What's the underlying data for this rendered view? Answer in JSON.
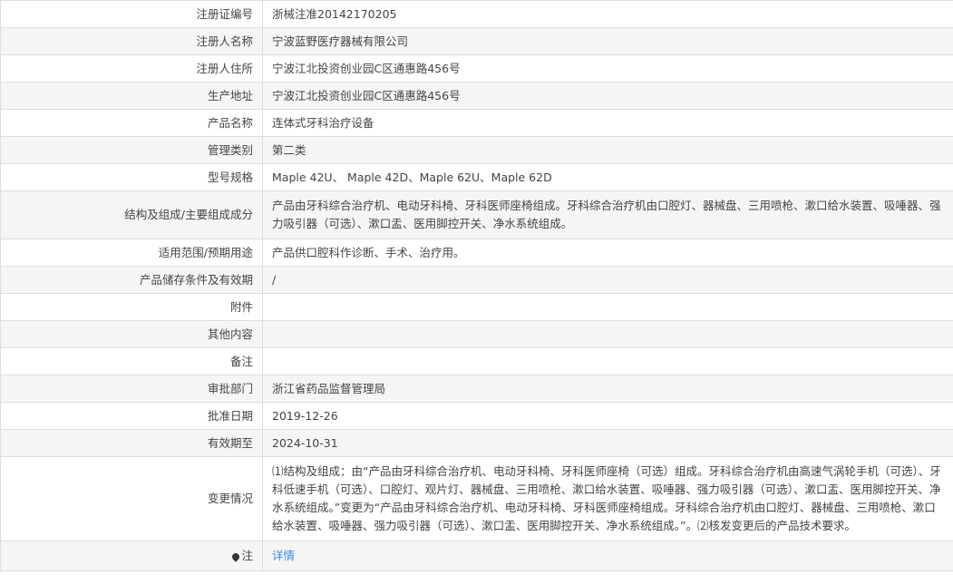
{
  "rows": [
    {
      "label": "注册证编号",
      "value": "浙械注准20142170205"
    },
    {
      "label": "注册人名称",
      "value": "宁波蓝野医疗器械有限公司"
    },
    {
      "label": "注册人住所",
      "value": "宁波江北投资创业园C区通惠路456号"
    },
    {
      "label": "生产地址",
      "value": "宁波江北投资创业园C区通惠路456号"
    },
    {
      "label": "产品名称",
      "value": "连体式牙科治疗设备"
    },
    {
      "label": "管理类别",
      "value": "第二类"
    },
    {
      "label": "型号规格",
      "value": "Maple 42U、 Maple 42D、Maple 62U、Maple 62D"
    },
    {
      "label": "结构及组成/主要组成成分",
      "value": "产品由牙科综合治疗机、电动牙科椅、牙科医师座椅组成。牙科综合治疗机由口腔灯、器械盘、三用喷枪、漱口给水装置、吸唾器、强力吸引器（可选）、漱口盂、医用脚控开关、净水系统组成。"
    },
    {
      "label": "适用范围/预期用途",
      "value": "产品供口腔科作诊断、手术、治疗用。"
    },
    {
      "label": "产品储存条件及有效期",
      "value": "/"
    },
    {
      "label": "附件",
      "value": ""
    },
    {
      "label": "其他内容",
      "value": ""
    },
    {
      "label": "备注",
      "value": ""
    },
    {
      "label": "审批部门",
      "value": "浙江省药品监督管理局"
    },
    {
      "label": "批准日期",
      "value": "2019-12-26"
    },
    {
      "label": "有效期至",
      "value": "2024-10-31"
    },
    {
      "label": "变更情况",
      "value": "⑴结构及组成：由“产品由牙科综合治疗机、电动牙科椅、牙科医师座椅（可选）组成。牙科综合治疗机由高速气涡轮手机（可选）、牙科低速手机（可选）、口腔灯、观片灯、器械盘、三用喷枪、漱口给水装置、吸唾器、强力吸引器（可选）、漱口盂、医用脚控开关、净水系统组成。”变更为“产品由牙科综合治疗机、电动牙科椅、牙科医师座椅组成。牙科综合治疗机由口腔灯、器械盘、三用喷枪、漱口给水装置、吸唾器、强力吸引器（可选）、漱口盂、医用脚控开关、净水系统组成。”。⑵核发变更后的产品技术要求。"
    }
  ],
  "note": {
    "label": "注",
    "link": "详情",
    "icon": "pin-icon"
  }
}
